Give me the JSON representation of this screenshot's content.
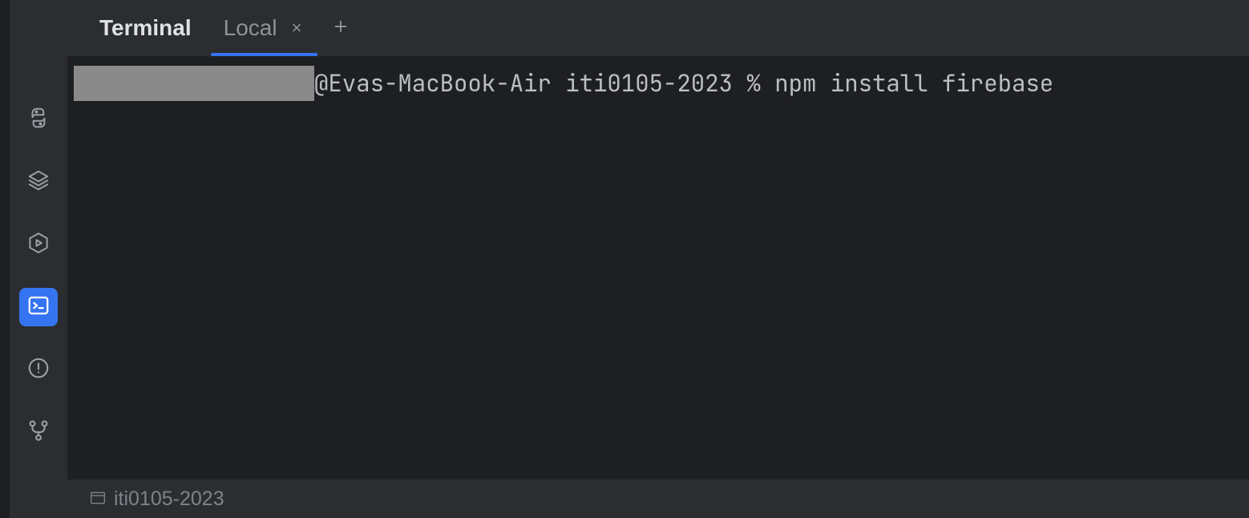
{
  "tabs": {
    "title": "Terminal",
    "secondary": "Local"
  },
  "terminal": {
    "line1": "@Evas-MacBook-Air iti0105-2023 % npm install firebase"
  },
  "statusBar": {
    "project": "iti0105-2023"
  }
}
